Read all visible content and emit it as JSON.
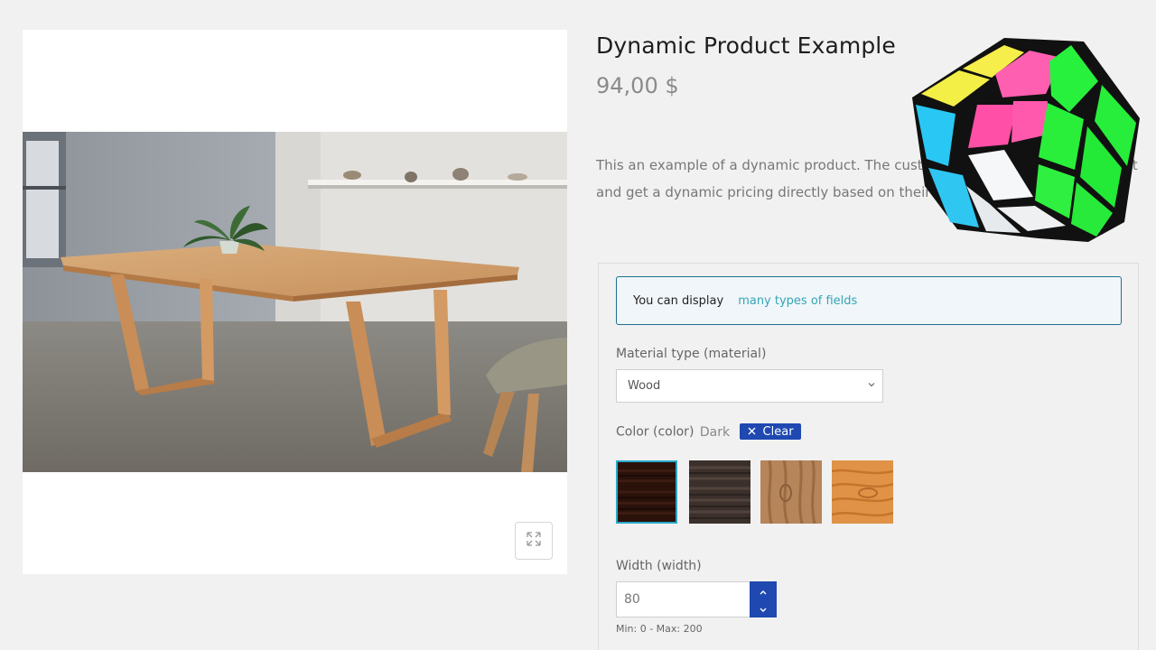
{
  "product": {
    "title": "Dynamic Product Example",
    "price": "94,00 $",
    "description": "This an example of a dynamic product. The customer can configure the product and get a dynamic pricing directly based on their input."
  },
  "gallery": {
    "image_alt": "Wooden dining table with plant",
    "zoom_icon": "expand-icon"
  },
  "form": {
    "notice": {
      "text": "You can display",
      "highlight": "many types of fields"
    },
    "material": {
      "label": "Material type (material)",
      "value": "Wood",
      "icon": "chevron-down-icon"
    },
    "color": {
      "label": "Color (color)",
      "selected_name": "Dark",
      "clear_label": "Clear",
      "clear_icon": "close-icon",
      "swatches": [
        {
          "name": "dark-wood",
          "selected": true
        },
        {
          "name": "weathered-wood",
          "selected": false
        },
        {
          "name": "light-oak",
          "selected": false
        },
        {
          "name": "pine-wood",
          "selected": false
        }
      ]
    },
    "width": {
      "label": "Width (width)",
      "value": "80",
      "hint": "Min: 0 - Max: 200"
    }
  },
  "colors": {
    "accent_blue": "#1f48b1",
    "notice_border": "#1e6f8e",
    "notice_link": "#33a6b6",
    "selected_swatch_border": "#2aa8c8"
  }
}
